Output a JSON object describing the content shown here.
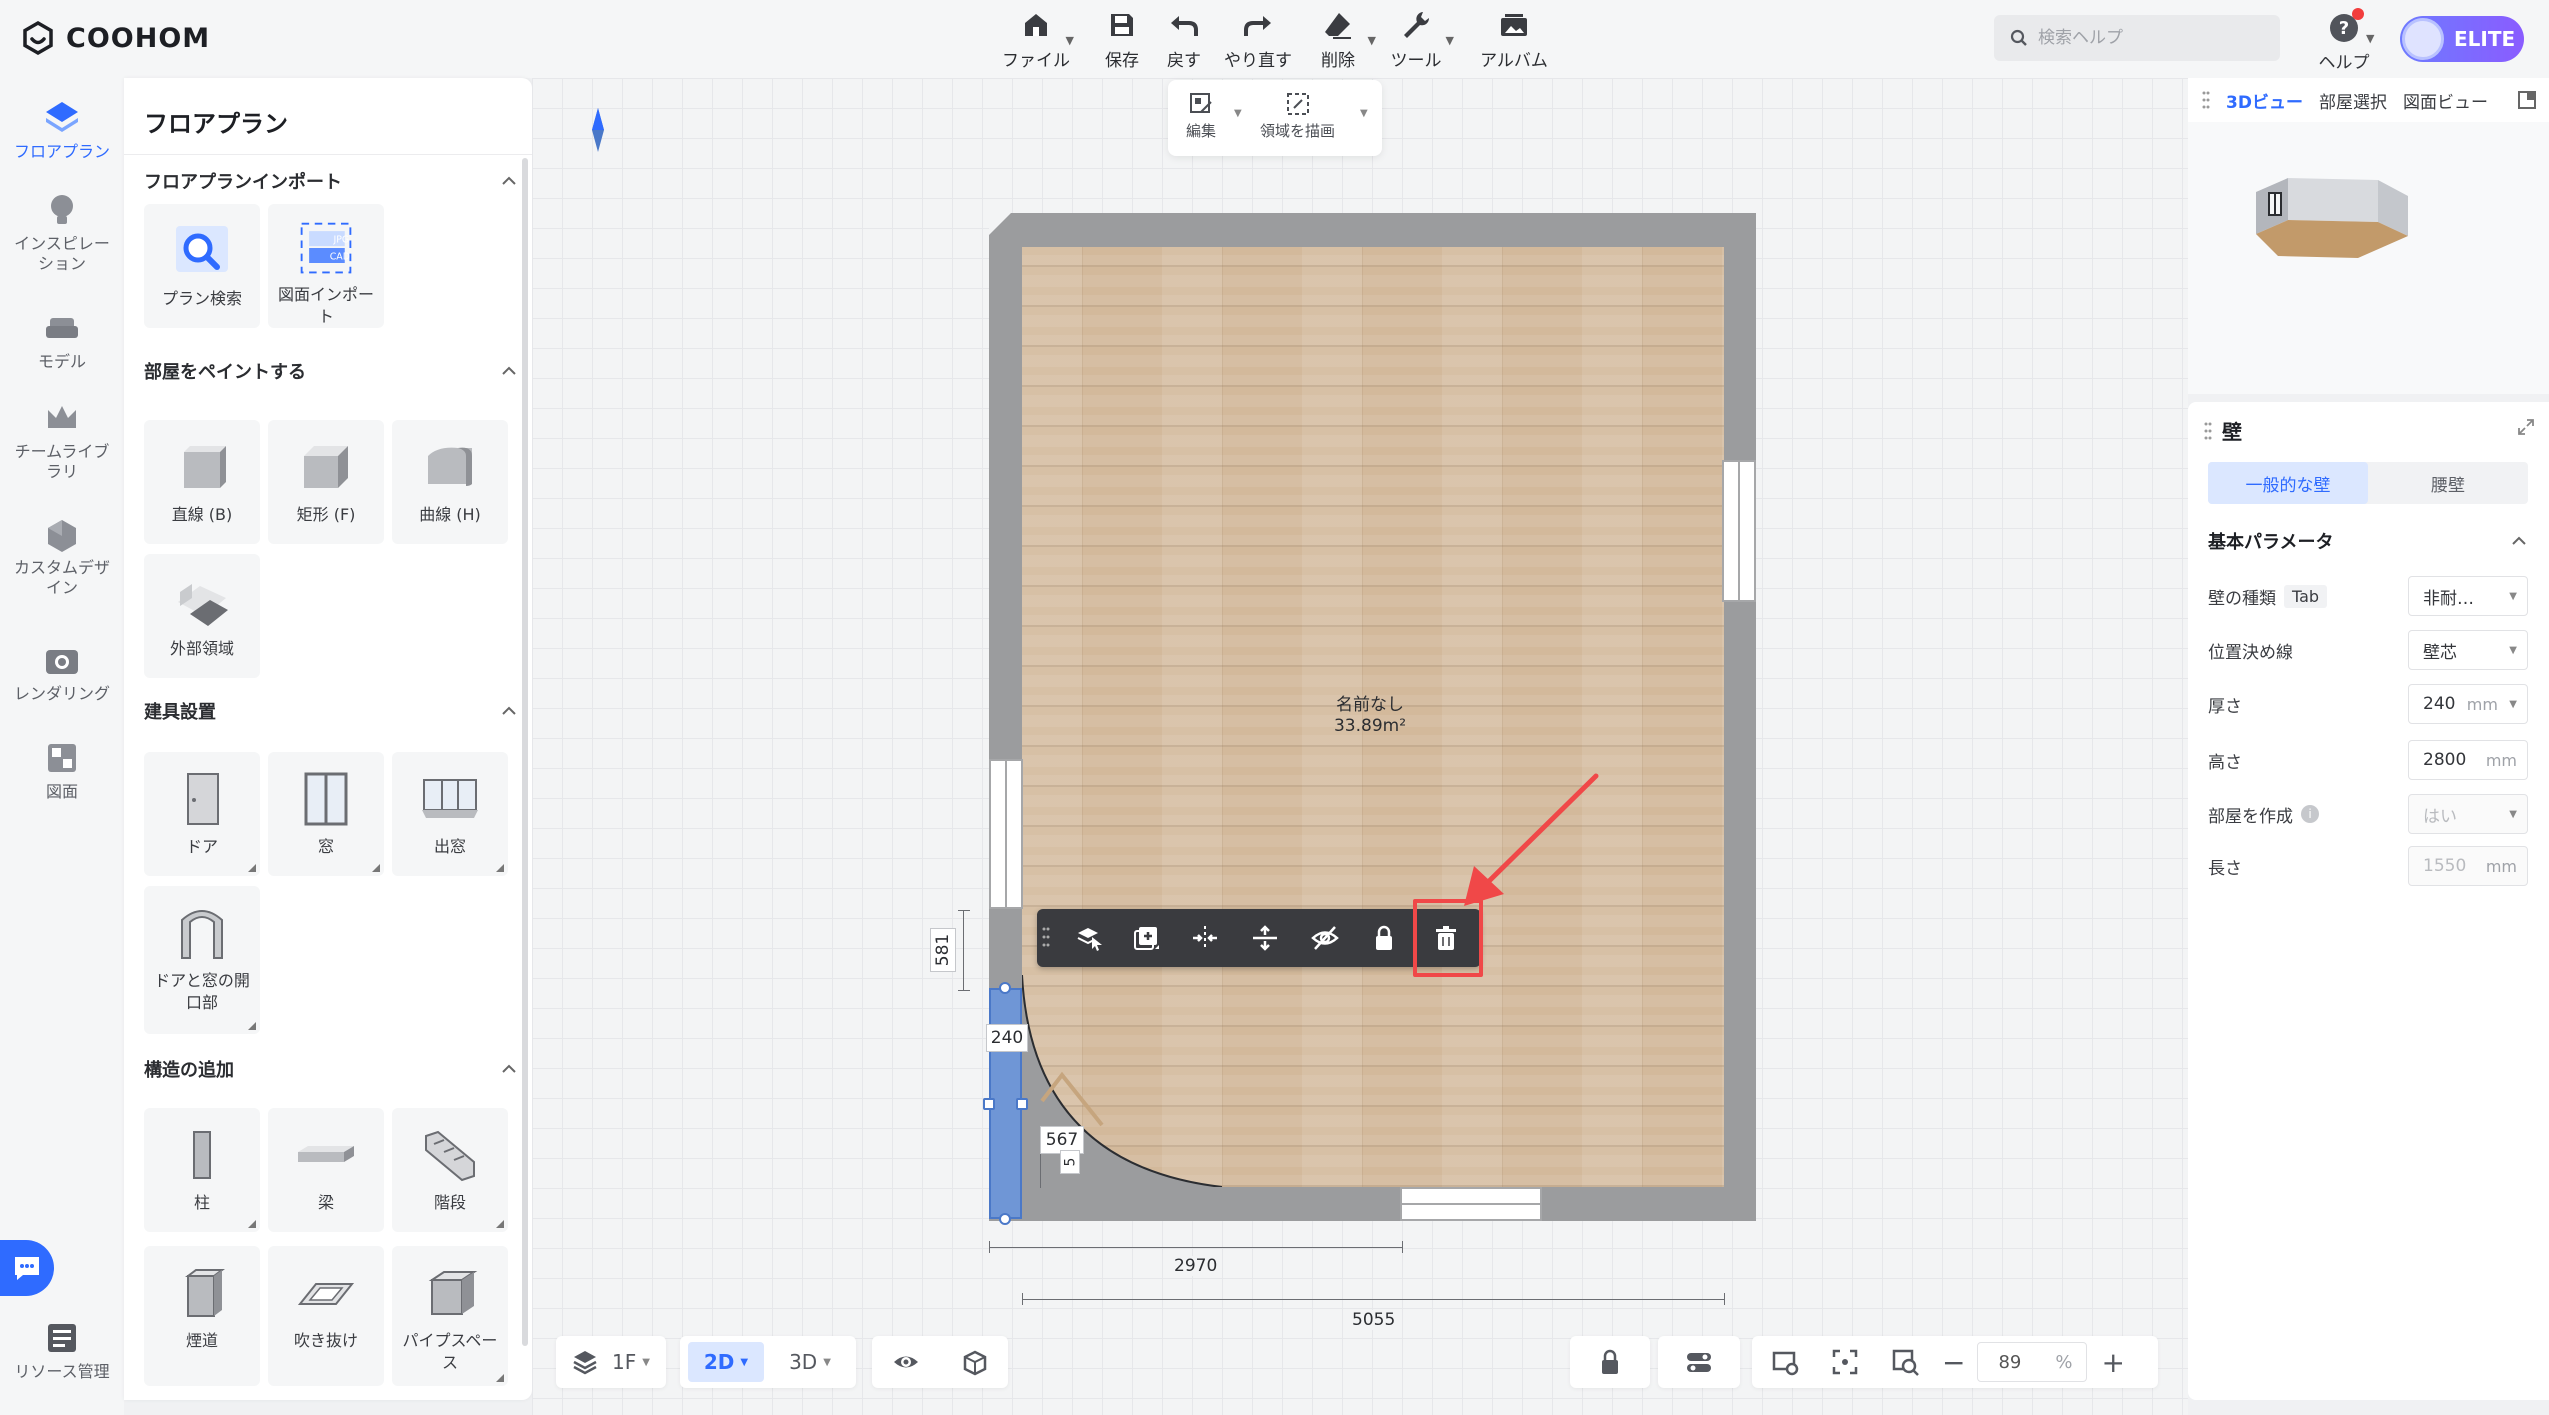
{
  "app": {
    "name": "COOHOM"
  },
  "toolbar": {
    "items": [
      {
        "label": "ファイル",
        "icon": "home-icon",
        "caret": true
      },
      {
        "label": "保存",
        "icon": "save-icon",
        "caret": false
      },
      {
        "label": "戻す",
        "icon": "undo-icon",
        "caret": false
      },
      {
        "label": "やり直す",
        "icon": "redo-icon",
        "caret": false
      },
      {
        "label": "削除",
        "icon": "eraser-icon",
        "caret": true
      },
      {
        "label": "ツール",
        "icon": "wrench-icon",
        "caret": true
      },
      {
        "label": "アルバム",
        "icon": "album-icon",
        "caret": false
      }
    ],
    "search_placeholder": "検索ヘルプ",
    "help_label": "ヘルプ",
    "elite_label": "ELITE"
  },
  "rail": {
    "items": [
      {
        "label": "フロアプラン",
        "icon": "floorplan-icon",
        "active": true
      },
      {
        "label": "インスピレーション",
        "icon": "lightbulb-icon",
        "active": false
      },
      {
        "label": "モデル",
        "icon": "sofa-icon",
        "active": false
      },
      {
        "label": "チームライブラリ",
        "icon": "crown-icon",
        "active": false
      },
      {
        "label": "カスタムデザイン",
        "icon": "custom-design-icon",
        "active": false
      },
      {
        "label": "レンダリング",
        "icon": "camera-icon",
        "active": false
      },
      {
        "label": "図面",
        "icon": "drawing-icon",
        "active": false
      }
    ],
    "resource_label": "リソース管理"
  },
  "panel": {
    "title": "フロアプラン",
    "sections": [
      {
        "title": "フロアプランインポート",
        "tiles": [
          {
            "label": "プラン検索",
            "icon": "plan-search-icon"
          },
          {
            "label": "図面インポート",
            "icon": "import-cad-icon"
          }
        ]
      },
      {
        "title": "部屋をペイントする",
        "tiles": [
          {
            "label": "直線 (B)",
            "icon": "cube-straight-icon"
          },
          {
            "label": "矩形 (F)",
            "icon": "cube-rect-icon"
          },
          {
            "label": "曲線 (H)",
            "icon": "cube-curve-icon"
          },
          {
            "label": "外部領域",
            "icon": "outdoor-area-icon"
          }
        ]
      },
      {
        "title": "建具設置",
        "tiles": [
          {
            "label": "ドア",
            "icon": "door-icon"
          },
          {
            "label": "窓",
            "icon": "window-icon"
          },
          {
            "label": "出窓",
            "icon": "bay-window-icon"
          },
          {
            "label": "ドアと窓の開口部",
            "icon": "opening-icon"
          }
        ]
      },
      {
        "title": "構造の追加",
        "tiles": [
          {
            "label": "柱",
            "icon": "column-icon"
          },
          {
            "label": "梁",
            "icon": "beam-icon"
          },
          {
            "label": "階段",
            "icon": "stairs-icon"
          },
          {
            "label": "煙道",
            "icon": "flue-icon"
          },
          {
            "label": "吹き抜け",
            "icon": "void-icon"
          },
          {
            "label": "パイプスペース",
            "icon": "pipe-space-icon"
          }
        ]
      }
    ]
  },
  "canvas": {
    "draw_popover": {
      "edit_label": "編集",
      "draw_area_label": "領域を描画"
    },
    "room": {
      "name": "名前なし",
      "area": "33.89m²"
    },
    "dimensions": {
      "left_height": "581",
      "wall_thickness": "240",
      "door_width": "567",
      "door_small": "5",
      "bottom_partial": "2970",
      "bottom_total": "5055"
    },
    "floating_toolbar": [
      "select-similar-icon",
      "copy-icon",
      "split-icon",
      "flip-icon",
      "hide-icon",
      "lock-icon",
      "trash-icon"
    ]
  },
  "bottom": {
    "floor_label": "1F",
    "view_2d": "2D",
    "view_3d": "3D",
    "zoom_value": "89",
    "zoom_unit": "%"
  },
  "view3d": {
    "tabs": [
      "3Dビュー",
      "部屋選択",
      "図面ビュー"
    ]
  },
  "props": {
    "title": "壁",
    "tabs": [
      "一般的な壁",
      "腰壁"
    ],
    "section_title": "基本パラメータ",
    "rows": [
      {
        "key": "壁の種類",
        "tag": "Tab",
        "value": "非耐…",
        "unit": "",
        "dropdown": true,
        "disabled": false
      },
      {
        "key": "位置決め線",
        "tag": "",
        "value": "壁芯",
        "unit": "",
        "dropdown": true,
        "disabled": false
      },
      {
        "key": "厚さ",
        "tag": "",
        "value": "240",
        "unit": "mm",
        "dropdown": true,
        "disabled": false
      },
      {
        "key": "高さ",
        "tag": "",
        "value": "2800",
        "unit": "mm",
        "dropdown": false,
        "disabled": false
      },
      {
        "key": "部屋を作成",
        "tag": "",
        "value": "はい",
        "unit": "",
        "dropdown": true,
        "disabled": true
      },
      {
        "key": "長さ",
        "tag": "",
        "value": "1550",
        "unit": "mm",
        "dropdown": false,
        "disabled": true
      }
    ]
  },
  "colors": {
    "accent": "#2f6bff",
    "highlight": "#f04848",
    "wall": "#9b9c9e",
    "selected_wall": "#6f96d6"
  }
}
